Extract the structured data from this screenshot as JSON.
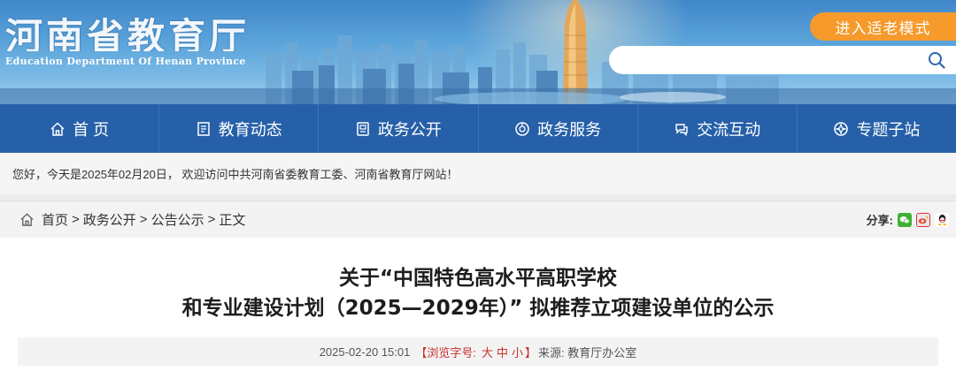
{
  "header": {
    "logo_cn": "河南省教育厅",
    "logo_en": "Education Department Of Henan Province",
    "elder_mode_label": "进入适老模式",
    "search_placeholder": ""
  },
  "nav": {
    "items": [
      {
        "label": "首 页",
        "icon": "home-icon"
      },
      {
        "label": "教育动态",
        "icon": "news-icon"
      },
      {
        "label": "政务公开",
        "icon": "document-icon"
      },
      {
        "label": "政务服务",
        "icon": "service-icon"
      },
      {
        "label": "交流互动",
        "icon": "interaction-icon"
      },
      {
        "label": "专题子站",
        "icon": "topic-icon"
      }
    ]
  },
  "welcome": {
    "text": "您好，今天是2025年02月20日， 欢迎访问中共河南省委教育工委、河南省教育厅网站！"
  },
  "breadcrumb": {
    "items": [
      "首页",
      "政务公开",
      "公告公示",
      "正文"
    ],
    "separator": ">",
    "share_label": "分享:"
  },
  "article": {
    "title_line1": "关于“中国特色高水平高职学校",
    "title_line2": "和专业建设计划（2025—2029年）” 拟推荐立项建设单位的公示",
    "date": "2025-02-20 15:01",
    "font_size_label_open": "【浏览字号:",
    "font_sizes": [
      "大",
      "中",
      "小"
    ],
    "font_size_label_close": "】",
    "source": "来源: 教育厅办公室"
  },
  "colors": {
    "nav_bg": "#2660a8",
    "elder_btn": "#f59a2b",
    "accent_red": "#c9302c"
  }
}
